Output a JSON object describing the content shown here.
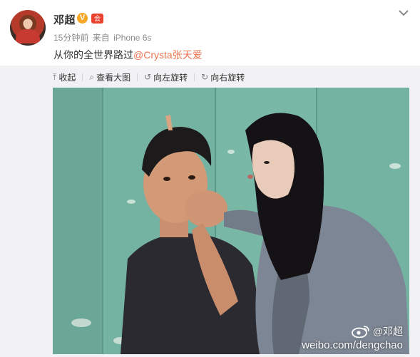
{
  "post": {
    "username": "邓超",
    "verified_badge": "V",
    "member_badge": "会",
    "time": "15分钟前",
    "source_prefix": "来自",
    "device": "iPhone 6s",
    "caption_text": "从你的全世界路过",
    "caption_mention": "@Crysta张天爱"
  },
  "toolbar": {
    "collapse": "收起",
    "view_large": "查看大图",
    "rotate_left": "向左旋转",
    "rotate_right": "向右旋转"
  },
  "image": {
    "watermark_name": "@邓超",
    "watermark_url": "weibo.com/dengchao"
  },
  "colors": {
    "mention": "#eb7350",
    "wall": "#6fae9e",
    "page_gray": "#f2f2f5"
  },
  "icons": [
    "chevron-down-icon",
    "collapse-arrow-icon",
    "magnifier-icon",
    "rotate-left-icon",
    "rotate-right-icon",
    "weibo-logo-icon"
  ]
}
